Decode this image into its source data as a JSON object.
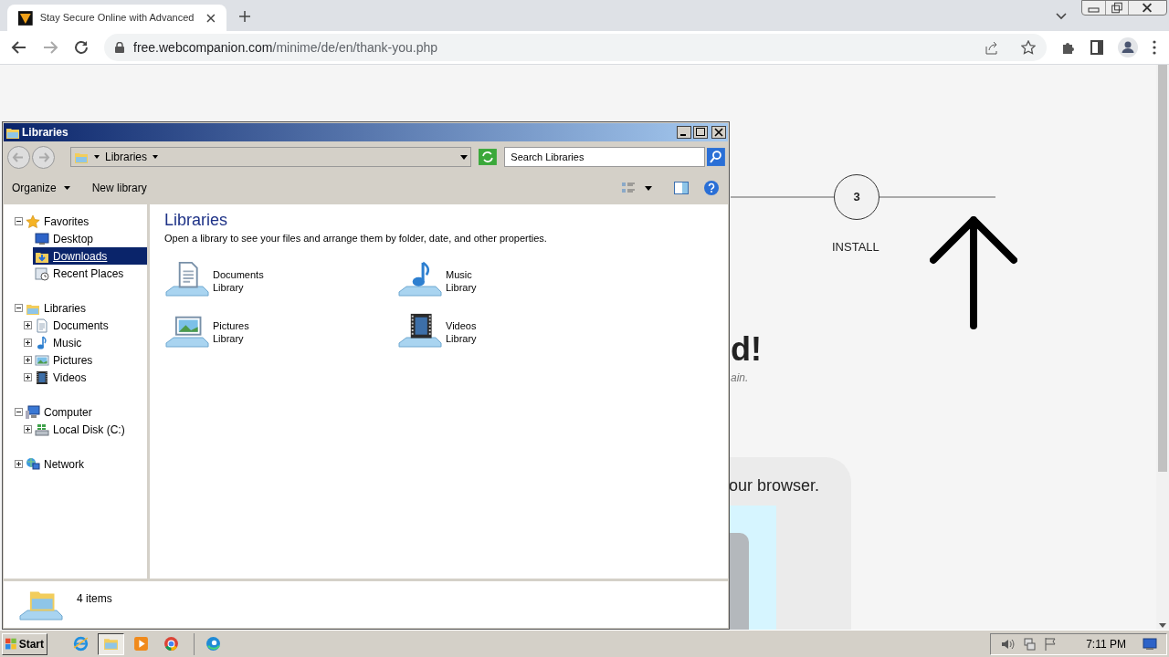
{
  "browser": {
    "tab_title": "Stay Secure Online with Advanced",
    "url_host": "free.webcompanion.com",
    "url_path": "/minime/de/en/thank-you.php"
  },
  "page": {
    "step_number": "3",
    "step_label": "INSTALL",
    "heading_fragment": "d!",
    "subtitle_fragment": "ain.",
    "card_text_fragment": "our browser."
  },
  "explorer": {
    "title": "Libraries",
    "address": "Libraries",
    "search_placeholder": "Search Libraries",
    "toolbar": [
      "Organize",
      "New library"
    ],
    "nav": [
      {
        "label": "Favorites",
        "kind": "star",
        "expanded": true,
        "selected": false,
        "children": [
          {
            "label": "Desktop",
            "kind": "desktop",
            "selected": false
          },
          {
            "label": "Downloads",
            "kind": "downloads",
            "selected": true
          },
          {
            "label": "Recent Places",
            "kind": "recent",
            "selected": false
          }
        ]
      },
      {
        "label": "Libraries",
        "kind": "library",
        "expanded": true,
        "selected": false,
        "children": [
          {
            "label": "Documents",
            "kind": "documents",
            "expanded": false,
            "selected": false
          },
          {
            "label": "Music",
            "kind": "music",
            "expanded": false,
            "selected": false
          },
          {
            "label": "Pictures",
            "kind": "pictures",
            "expanded": false,
            "selected": false
          },
          {
            "label": "Videos",
            "kind": "videos",
            "expanded": false,
            "selected": false
          }
        ]
      },
      {
        "label": "Computer",
        "kind": "computer",
        "expanded": true,
        "selected": false,
        "children": [
          {
            "label": "Local Disk (C:)",
            "kind": "disk",
            "expanded": false,
            "selected": false
          }
        ]
      },
      {
        "label": "Network",
        "kind": "network",
        "expanded": false,
        "selected": false
      }
    ],
    "heading": "Libraries",
    "description": "Open a library to see your files and arrange them by folder, date, and other properties.",
    "libraries": [
      {
        "name": "Documents",
        "type": "Library",
        "kind": "documents"
      },
      {
        "name": "Music",
        "type": "Library",
        "kind": "music"
      },
      {
        "name": "Pictures",
        "type": "Library",
        "kind": "pictures"
      },
      {
        "name": "Videos",
        "type": "Library",
        "kind": "videos"
      }
    ],
    "status": "4 items"
  },
  "taskbar": {
    "start": "Start",
    "clock": "7:11 PM",
    "apps": [
      {
        "kind": "ie",
        "active": false
      },
      {
        "kind": "explorer",
        "active": true
      },
      {
        "kind": "media",
        "active": false
      },
      {
        "kind": "chrome",
        "active": false
      },
      {
        "kind": "edge",
        "active": false
      }
    ]
  }
}
